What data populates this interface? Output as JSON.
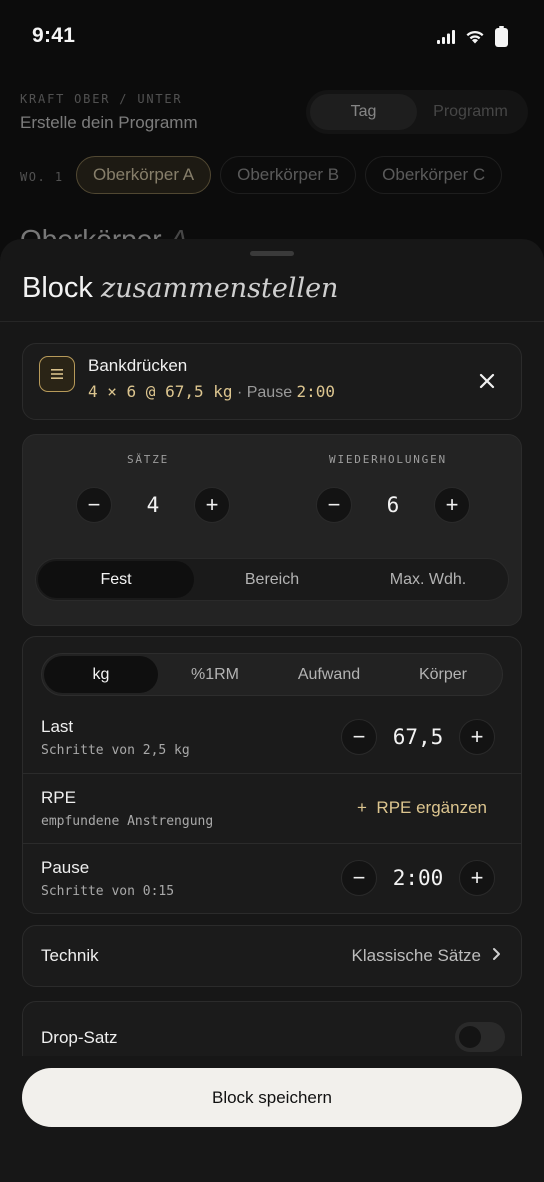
{
  "status_bar": {
    "time": "9:41"
  },
  "background": {
    "eyebrow": "KRAFT OBER / UNTER",
    "title": "Erstelle dein Programm",
    "segment": [
      "Tag",
      "Programm"
    ],
    "week_label": "WO. 1",
    "day_chips": [
      "Oberkörper A",
      "Oberkörper B",
      "Oberkörper C"
    ],
    "heading": "Oberkörper",
    "heading_suffix": "A"
  },
  "sheet": {
    "title_plain": "Block",
    "title_italic": "zusammenstellen",
    "exercise": {
      "name": "Bankdrücken",
      "summary_sets": "4 × 6 @ 67,5 kg",
      "summary_sep": " · Pause ",
      "summary_rest": "2:00",
      "icon": "list-icon"
    },
    "sets": {
      "label": "SÄTZE",
      "value": "4"
    },
    "reps": {
      "label": "WIEDERHOLUNGEN",
      "value": "6"
    },
    "rep_mode": {
      "options": [
        "Fest",
        "Bereich",
        "Max. Wdh."
      ],
      "selected": "Fest"
    },
    "load_mode": {
      "options": [
        "kg",
        "%1RM",
        "Aufwand",
        "Körper"
      ],
      "selected": "kg"
    },
    "load": {
      "title": "Last",
      "subtitle": "Schritte von 2,5 kg",
      "value": "67,5"
    },
    "rpe": {
      "title": "RPE",
      "subtitle": "empfundene Anstrengung",
      "action": "+  RPE ergänzen"
    },
    "rest": {
      "title": "Pause",
      "subtitle": "Schritte von 0:15",
      "value": "2:00"
    },
    "technique": {
      "label": "Technik",
      "value": "Klassische Sätze"
    },
    "drop_set": {
      "label": "Drop-Satz",
      "enabled": false
    },
    "save_label": "Block speichern"
  },
  "colors": {
    "accent": "#dcc58f",
    "sheet_bg": "#171717",
    "page_bg": "#0c0c0c"
  }
}
